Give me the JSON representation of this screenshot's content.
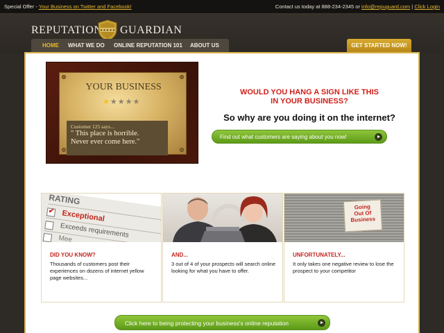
{
  "topbar": {
    "offer_label": "Special Offer - ",
    "offer_link": "Your Business on Twitter and Facebook!",
    "contact_label": "Contact us today at 888-234-2345 or ",
    "email": "info@repuguard.com",
    "separator": " | ",
    "login": "Click Login"
  },
  "brand": {
    "word1": "REPUTATION",
    "word2": "GUARDIAN",
    "stars": "★★★★★"
  },
  "nav": {
    "items": [
      {
        "label": "HOME",
        "active": true
      },
      {
        "label": "WHAT WE DO",
        "active": false
      },
      {
        "label": "ONLINE REPUTATION 101",
        "active": false
      },
      {
        "label": "ABOUT US",
        "active": false
      }
    ],
    "cta": "GET STARTED NOW!"
  },
  "hero": {
    "plaque": {
      "business": "YOUR BUSINESS",
      "stars_on": "★",
      "stars_off": "★★★★",
      "says": "Customer 125 says...",
      "quote1": "\" This place is horrible.",
      "quote2": "Never ever come here.\""
    },
    "headline_red_1": "WOULD YOU HANG A SIGN LIKE  THIS",
    "headline_red_2": "IN YOUR BUSINESS?",
    "headline_black": "So why are you doing it on the internet?",
    "button": "Find out what customers are saying about you now!"
  },
  "cards": [
    {
      "title": "DID YOU KNOW?",
      "body": "Thousands of customers post their experiences on dozens of internet yellow page websites...",
      "img": {
        "heading": "RATING",
        "opt1": "Exceptional",
        "opt2": "Exceeds requirements",
        "opt3": "Mee"
      }
    },
    {
      "title": "AND...",
      "body": "3 out of 4 of your prospects will search online looking for what you have to offer."
    },
    {
      "title": "UNFORTUNATELY...",
      "body": "It only takes one negative review to lose the prospect to your competitor",
      "img": {
        "sign1": "Going",
        "sign2": "Out Of",
        "sign3": "Business"
      }
    }
  ],
  "bottom_cta": "Click here to being protecting your business's online reputation",
  "colors": {
    "accent": "#e5b830",
    "red": "#c2251d",
    "green": "#6aa824",
    "bg": "#2e2a25"
  }
}
